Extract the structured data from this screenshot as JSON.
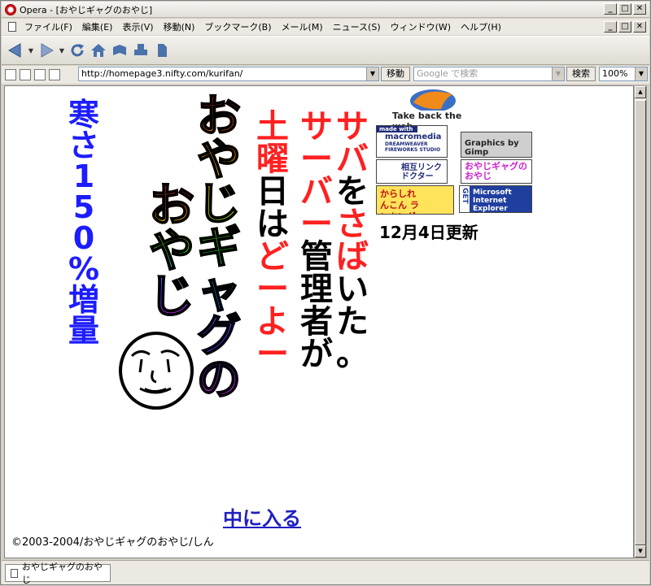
{
  "window": {
    "title": "Opera - [おやじギャグのおやじ]",
    "minimize": "_",
    "maximize": "□",
    "close": "✕"
  },
  "menu": {
    "items": [
      "ファイル(F)",
      "編集(E)",
      "表示(V)",
      "移動(N)",
      "ブックマーク(B)",
      "メール(M)",
      "ニュース(S)",
      "ウィンドウ(W)",
      "ヘルプ(H)"
    ]
  },
  "address": {
    "url": "http://homepage3.nifty.com/kurifan/",
    "go_label": "移動",
    "search_placeholder": "Google で検索",
    "search_label": "検索",
    "zoom": "100%"
  },
  "page": {
    "vertical_blue": "寒さ150%増量",
    "rainbow_col1": "おやじギャグの",
    "rainbow_col2": "おやじ",
    "vertical_red_top": "土曜日はどーよー",
    "server_red": "サーバー",
    "server_black": "管理者が",
    "saba_red": "サバ",
    "saba_black": "を",
    "saba_red2": "さば",
    "saba_black2": "いた。",
    "firefox_caption": "Take back the web",
    "badges": {
      "macromedia_top": "made with",
      "macromedia_name": "macromedia",
      "macromedia_products": "DREAMWEAVER FIREWORKS STUDIO",
      "gimp": "Graphics by Gimp",
      "link_doctor": "相互リンク ドクター",
      "oyaji_logo": "おやじギャグの おやじ",
      "ranking": "からしれんこん ランキング",
      "ie_get": "GET",
      "ie_name": "Microsoft Internet Explorer"
    },
    "updated": "12月4日更新",
    "enter_link": "中に入る",
    "copyright": "©2003-2004/おやじギャグのおやじ/しん"
  },
  "status": {
    "tab_label": "おやじギャグのおやじ"
  }
}
